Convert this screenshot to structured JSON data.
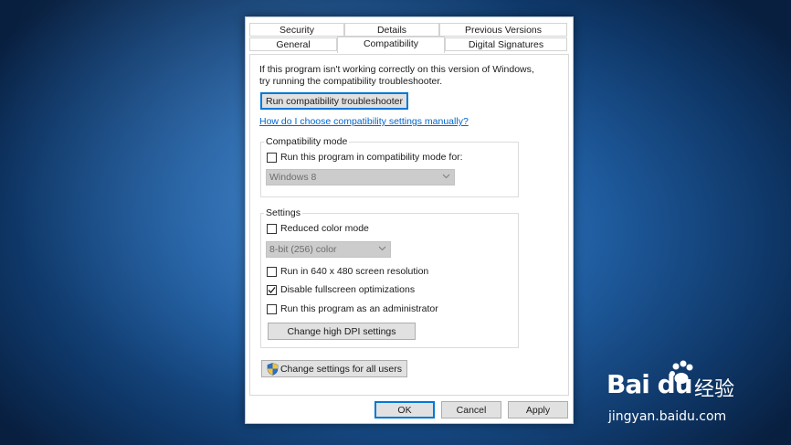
{
  "tabs_row1": [
    {
      "label": "Security"
    },
    {
      "label": "Details"
    },
    {
      "label": "Previous Versions"
    }
  ],
  "tabs_row2": [
    {
      "label": "General"
    },
    {
      "label": "Compatibility",
      "active": true
    },
    {
      "label": "Digital Signatures"
    }
  ],
  "intro": {
    "line1": "If this program isn't working correctly on this version of Windows,",
    "line2": "try running the compatibility troubleshooter."
  },
  "troubleshooter_button": "Run compatibility troubleshooter",
  "help_link": "How do I choose compatibility settings manually?",
  "compat_mode": {
    "title": "Compatibility mode",
    "checkbox_label": "Run this program in compatibility mode for:",
    "checked": false,
    "os_selected": "Windows 8"
  },
  "settings": {
    "title": "Settings",
    "reduced_color": {
      "label": "Reduced color mode",
      "checked": false
    },
    "color_selected": "8-bit (256) color",
    "res_640": {
      "label": "Run in 640 x 480 screen resolution",
      "checked": false
    },
    "fullscreen": {
      "label": "Disable fullscreen optimizations",
      "checked": true
    },
    "admin": {
      "label": "Run this program as an administrator",
      "checked": false
    },
    "dpi_button": "Change high DPI settings"
  },
  "all_users_button": "Change settings for all users",
  "footer": {
    "ok": "OK",
    "cancel": "Cancel",
    "apply": "Apply"
  },
  "watermark": {
    "brand": "Bai du",
    "cn_text": "经验",
    "url": "jingyan.baidu.com"
  },
  "colors": {
    "accent": "#0078d7",
    "link": "#0066cc",
    "disabled_select": "#cccccc"
  }
}
